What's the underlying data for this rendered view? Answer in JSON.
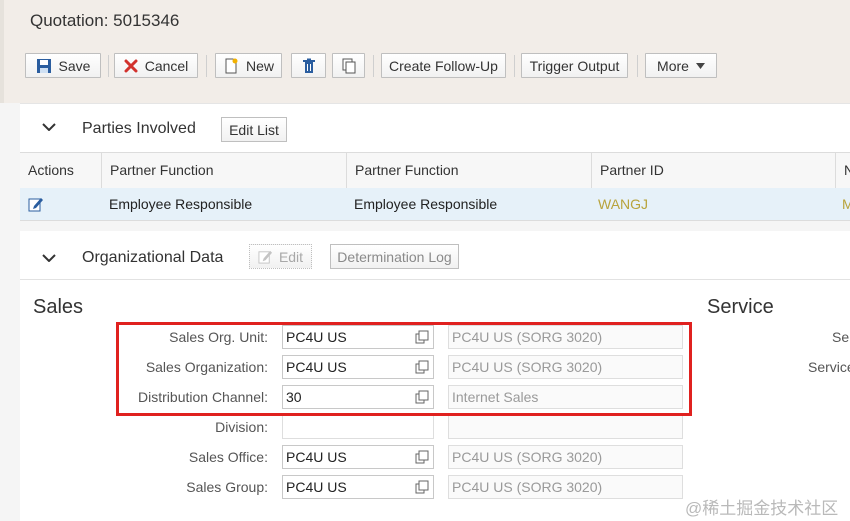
{
  "header": {
    "title": "Quotation: 5015346",
    "toolbar": {
      "save": "Save",
      "cancel": "Cancel",
      "new": "New",
      "create_follow_up": "Create Follow-Up",
      "trigger_output": "Trigger Output",
      "more": "More"
    }
  },
  "parties": {
    "title": "Parties Involved",
    "edit_list": "Edit List",
    "columns": [
      "Actions",
      "Partner Function",
      "Partner Function",
      "Partner ID",
      "N"
    ],
    "rows": [
      {
        "partner_function": "Employee Responsible",
        "partner_function_2": "Employee Responsible",
        "partner_id": "WANGJ",
        "name_partial": "M"
      }
    ]
  },
  "org": {
    "title": "Organizational Data",
    "edit": "Edit",
    "determination_log": "Determination Log",
    "sales_title": "Sales",
    "service_title": "Service",
    "service_labels": [
      "Ser",
      "Service"
    ],
    "fields": [
      {
        "label": "Sales Org. Unit:",
        "value": "PC4U US",
        "desc": "PC4U US (SORG 3020)"
      },
      {
        "label": "Sales Organization:",
        "value": "PC4U US",
        "desc": "PC4U US (SORG 3020)"
      },
      {
        "label": "Distribution Channel:",
        "value": "30",
        "desc": "Internet Sales"
      },
      {
        "label": "Division:",
        "value": "",
        "desc": ""
      },
      {
        "label": "Sales Office:",
        "value": "PC4U US",
        "desc": "PC4U US (SORG 3020)"
      },
      {
        "label": "Sales Group:",
        "value": "PC4U US",
        "desc": "PC4U US (SORG 3020)"
      }
    ]
  },
  "watermark": "@稀土掘金技术社区",
  "colors": {
    "header_bg": "#f2ede8",
    "row_selected": "#e6f1f9",
    "link": "#b8a33c",
    "highlight": "#e0211f"
  }
}
